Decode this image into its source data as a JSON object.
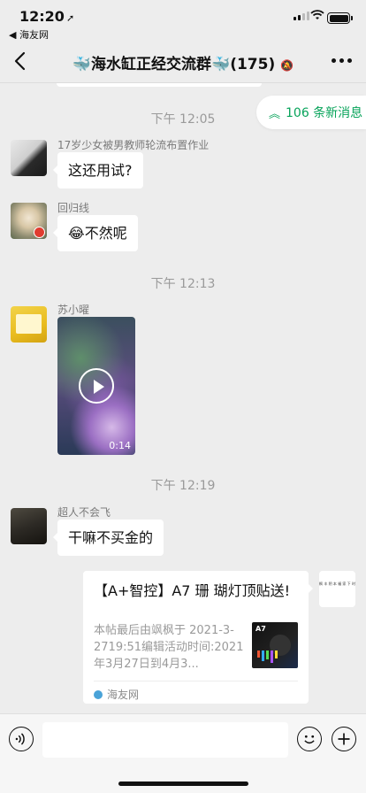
{
  "status": {
    "time": "12:20",
    "location_arrow": "➚",
    "back_app": "◀ 海友网"
  },
  "nav": {
    "title": "🐳海水缸正经交流群🐳(175)",
    "mute_icon": "bell-off-icon"
  },
  "new_messages": {
    "label": "106 条新消息",
    "chevron": "︽"
  },
  "messages": [
    {
      "type": "time",
      "text": "下午 12:05"
    },
    {
      "type": "text",
      "sender": "17岁少女被男教师轮流布置作业",
      "text": "这还用试?"
    },
    {
      "type": "text",
      "sender": "回归线",
      "text": "😂不然呢"
    },
    {
      "type": "time",
      "text": "下午 12:13"
    },
    {
      "type": "video",
      "sender": "苏小曜",
      "duration": "0:14"
    },
    {
      "type": "time",
      "text": "下午 12:19"
    },
    {
      "type": "text",
      "sender": "超人不会飞",
      "text": "干嘛不买金的"
    },
    {
      "type": "link",
      "title": "【A+智控】A7 珊 瑚灯顶贴送!",
      "description": "本帖最后由飒枫于 2021-3-2719:51编辑活动时间:2021年3月27日到4月3...",
      "thumb_label": "A7",
      "source": "海友网",
      "self_avatar_text": "枫 丰 阴 本 福 家 下 时"
    }
  ],
  "colors": {
    "background": "#ededed",
    "accent_green": "#07a35a"
  }
}
